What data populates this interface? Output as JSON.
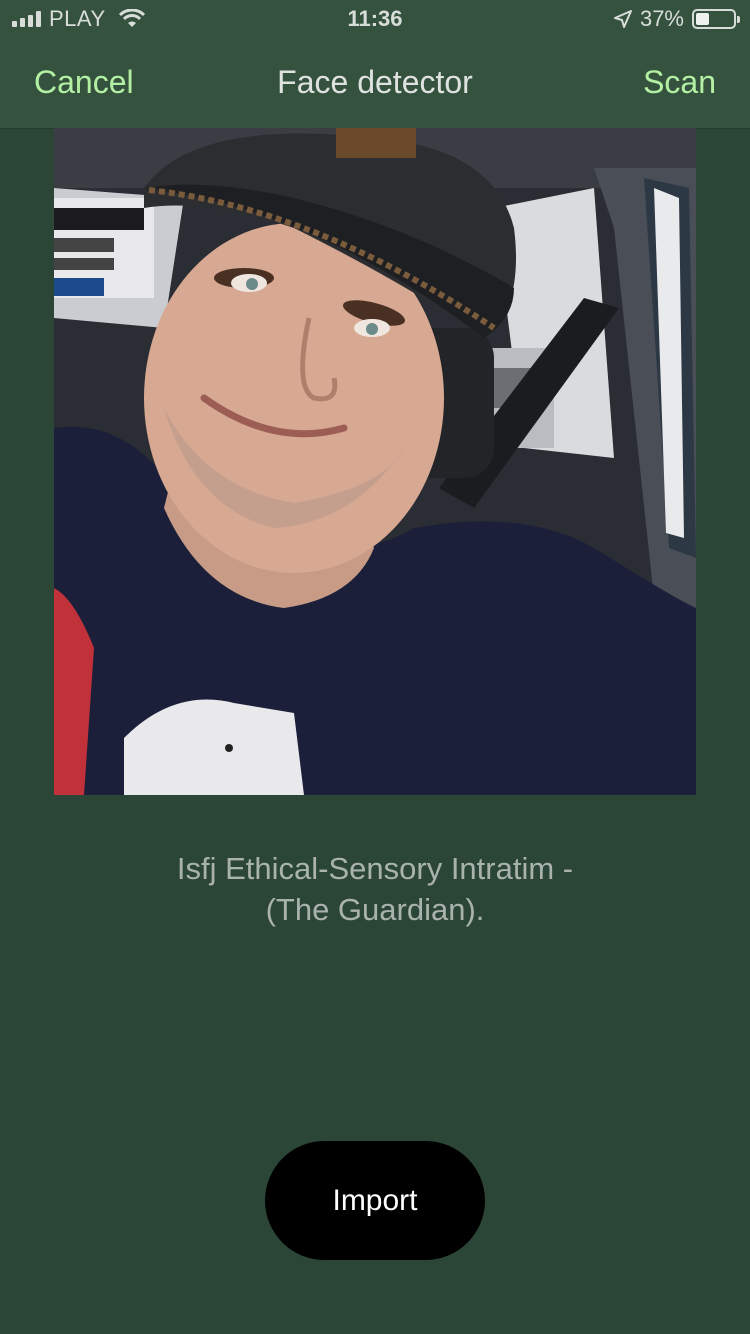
{
  "status_bar": {
    "carrier": "PLAY",
    "time": "11:36",
    "battery_percent": "37%",
    "battery_level": 0.37
  },
  "nav": {
    "cancel_label": "Cancel",
    "title": "Face detector",
    "scan_label": "Scan"
  },
  "photo": {
    "subject": "selfie of a man in a dark cap inside a car"
  },
  "result": {
    "line1": "Isfj Ethical-Sensory Intratim -",
    "line2": "(The Guardian)."
  },
  "import_label": "Import",
  "colors": {
    "background": "#2b4636",
    "nav_background": "#35523f",
    "accent": "#b4f0a4",
    "result_text": "#a9b2ac",
    "import_button": "#000000"
  }
}
